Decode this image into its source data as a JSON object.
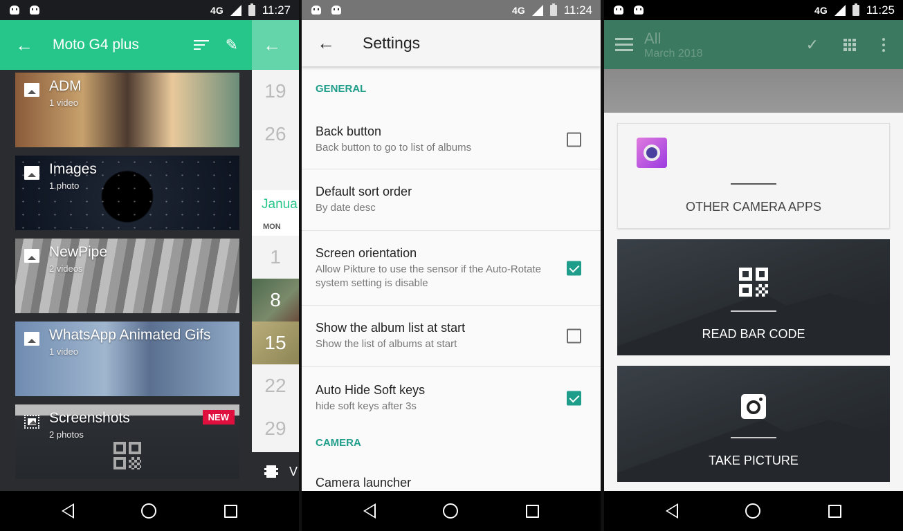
{
  "screens": {
    "gallery": {
      "status": {
        "network": "4G",
        "time": "11:27"
      },
      "appbar": {
        "title": "Moto G4 plus",
        "back_icon": "←",
        "edit_icon": "✎"
      },
      "albums": [
        {
          "name": "ADM",
          "count": "1 video"
        },
        {
          "name": "Images",
          "count": "1 photo"
        },
        {
          "name": "NewPipe",
          "count": "2 videos"
        },
        {
          "name": "WhatsApp Animated Gifs",
          "count": "1 video"
        },
        {
          "name": "Screenshots",
          "count": "2 photos",
          "badge": "NEW"
        }
      ],
      "calendar": {
        "back_icon": "←",
        "days_top": [
          "19",
          "26"
        ],
        "month": "Janua",
        "weekday": "MON",
        "days": [
          "1",
          "8",
          "15",
          "22",
          "29"
        ],
        "footer_text": "V"
      }
    },
    "settings": {
      "status": {
        "network": "4G",
        "time": "11:24"
      },
      "appbar": {
        "title": "Settings",
        "back_icon": "←"
      },
      "sections": {
        "general": "GENERAL",
        "camera": "CAMERA"
      },
      "prefs": [
        {
          "title": "Back button",
          "summary": "Back button to go to list of albums",
          "checked": false
        },
        {
          "title": "Default sort order",
          "summary": "By date desc"
        },
        {
          "title": "Screen orientation",
          "summary": "Allow Pikture to use the sensor if the Auto-Rotate system setting is disable",
          "checked": true
        },
        {
          "title": "Show the album list at start",
          "summary": "Show the list of albums at start",
          "checked": false
        },
        {
          "title": "Auto Hide Soft keys",
          "summary": "hide soft keys after 3s",
          "checked": true
        }
      ],
      "cut_item": "Camera launcher"
    },
    "camera": {
      "status": {
        "network": "4G",
        "time": "11:25"
      },
      "appbar": {
        "title": "All",
        "subtitle": "March 2018",
        "check_icon": "✓"
      },
      "cards": [
        {
          "label": "OTHER CAMERA APPS"
        },
        {
          "label": "READ BAR CODE"
        },
        {
          "label": "TAKE PICTURE"
        }
      ]
    }
  },
  "colors": {
    "gallery_accent": "#26c68a",
    "settings_accent": "#1e9e8a",
    "badge": "#e0103e"
  }
}
